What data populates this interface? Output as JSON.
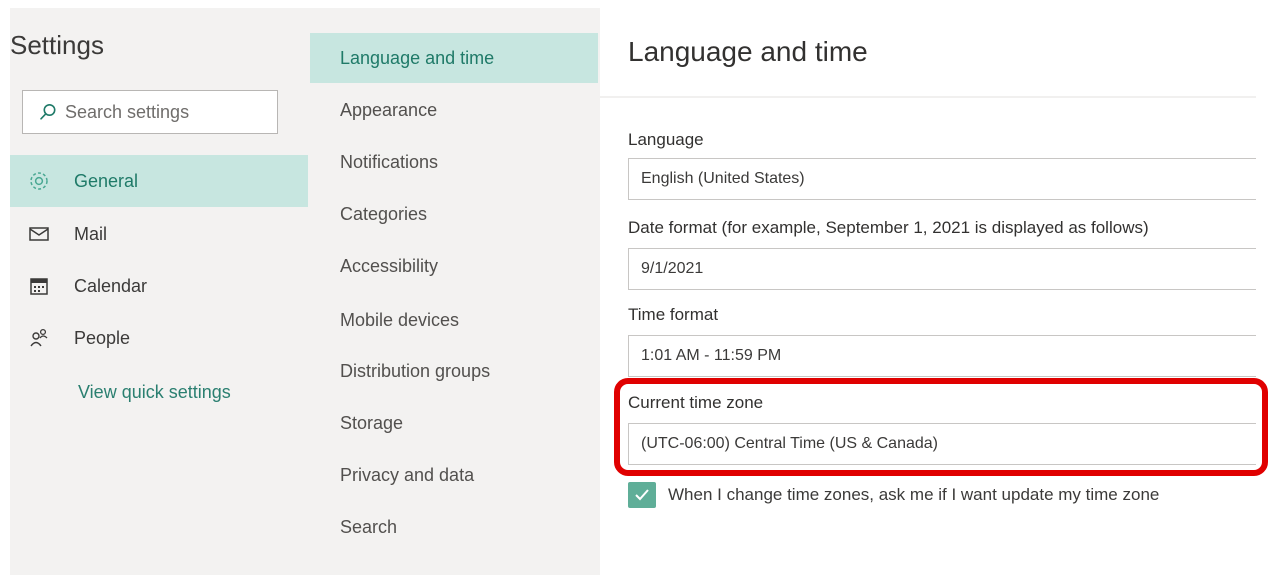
{
  "settings_title": "Settings",
  "search": {
    "placeholder": "Search settings"
  },
  "nav": [
    {
      "label": "General",
      "icon": "gear-icon",
      "active": true
    },
    {
      "label": "Mail",
      "icon": "mail-icon",
      "active": false
    },
    {
      "label": "Calendar",
      "icon": "calendar-icon",
      "active": false
    },
    {
      "label": "People",
      "icon": "people-icon",
      "active": false
    }
  ],
  "view_quick_settings": "View quick settings",
  "subnav": [
    {
      "label": "Language and time",
      "active": true
    },
    {
      "label": "Appearance",
      "active": false
    },
    {
      "label": "Notifications",
      "active": false
    },
    {
      "label": "Categories",
      "active": false
    },
    {
      "label": "Accessibility",
      "active": false
    },
    {
      "label": "Mobile devices",
      "active": false
    },
    {
      "label": "Distribution groups",
      "active": false
    },
    {
      "label": "Storage",
      "active": false
    },
    {
      "label": "Privacy and data",
      "active": false
    },
    {
      "label": "Search",
      "active": false
    }
  ],
  "pane": {
    "title": "Language and time",
    "language": {
      "label": "Language",
      "value": "English (United States)"
    },
    "date_format": {
      "label": "Date format (for example, September 1, 2021 is displayed as follows)",
      "value": "9/1/2021"
    },
    "time_format": {
      "label": "Time format",
      "value": "1:01 AM - 11:59 PM"
    },
    "time_zone": {
      "label": "Current time zone",
      "value": "(UTC-06:00) Central Time (US & Canada)"
    },
    "tz_prompt": {
      "label": "When I change time zones, ask me if I want update my time zone",
      "checked": true
    }
  },
  "colors": {
    "accent": "#1f7a68",
    "active_bg": "#c7e6e0",
    "highlight": "#e00000",
    "checkbox": "#5fae98"
  }
}
